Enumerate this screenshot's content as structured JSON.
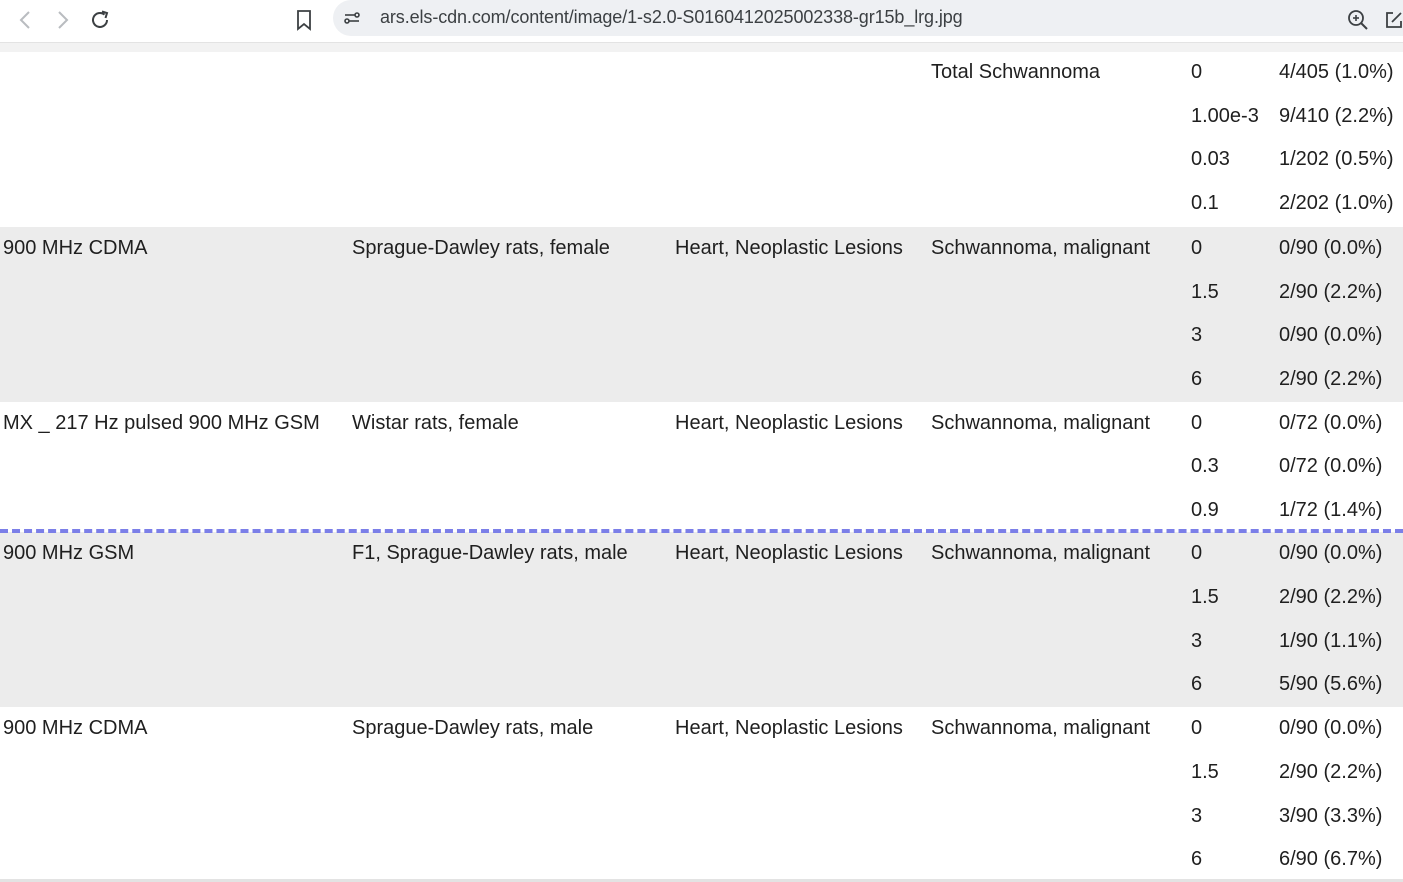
{
  "browser": {
    "url": "ars.els-cdn.com/content/image/1-s2.0-S0160412025002338-gr15b_lrg.jpg",
    "icons": [
      "back-icon",
      "forward-icon",
      "reload-icon",
      "bookmark-icon",
      "site-info-icon",
      "zoom-icon",
      "share-icon"
    ]
  },
  "table": {
    "groups": [
      {
        "exposure": "",
        "subject": "",
        "organ": "",
        "lesion": "Total Schwannoma",
        "shaded": false,
        "rows": [
          {
            "dose": "0",
            "incidence": "4/405 (1.0%)"
          },
          {
            "dose": "1.00e-3",
            "incidence": "9/410 (2.2%)"
          },
          {
            "dose": "0.03",
            "incidence": "1/202 (0.5%)"
          },
          {
            "dose": "0.1",
            "incidence": "2/202 (1.0%)"
          }
        ]
      },
      {
        "exposure": "900 MHz CDMA",
        "subject": "Sprague-Dawley rats, female",
        "organ": "Heart, Neoplastic Lesions",
        "lesion": "Schwannoma, malignant",
        "shaded": true,
        "rows": [
          {
            "dose": "0",
            "incidence": "0/90 (0.0%)"
          },
          {
            "dose": "1.5",
            "incidence": "2/90 (2.2%)"
          },
          {
            "dose": "3",
            "incidence": "0/90 (0.0%)"
          },
          {
            "dose": "6",
            "incidence": "2/90 (2.2%)"
          }
        ]
      },
      {
        "exposure": "MX _ 217 Hz pulsed 900 MHz GSM",
        "subject": "Wistar rats, female",
        "organ": "Heart, Neoplastic Lesions",
        "lesion": "Schwannoma, malignant",
        "shaded": false,
        "rows": [
          {
            "dose": "0",
            "incidence": "0/72 (0.0%)"
          },
          {
            "dose": "0.3",
            "incidence": "0/72 (0.0%)"
          },
          {
            "dose": "0.9",
            "incidence": "1/72 (1.4%)"
          }
        ]
      },
      {
        "exposure": "900 MHz GSM",
        "subject": "F1, Sprague-Dawley rats, male",
        "organ": "Heart, Neoplastic Lesions",
        "lesion": "Schwannoma, malignant",
        "shaded": true,
        "rows": [
          {
            "dose": "0",
            "incidence": "0/90 (0.0%)"
          },
          {
            "dose": "1.5",
            "incidence": "2/90 (2.2%)"
          },
          {
            "dose": "3",
            "incidence": "1/90 (1.1%)"
          },
          {
            "dose": "6",
            "incidence": "5/90 (5.6%)"
          }
        ]
      },
      {
        "exposure": "900 MHz CDMA",
        "subject": "Sprague-Dawley rats, male",
        "organ": "Heart, Neoplastic Lesions",
        "lesion": "Schwannoma, malignant",
        "shaded": false,
        "rows": [
          {
            "dose": "0",
            "incidence": "0/90 (0.0%)"
          },
          {
            "dose": "1.5",
            "incidence": "2/90 (2.2%)"
          },
          {
            "dose": "3",
            "incidence": "3/90 (3.3%)"
          },
          {
            "dose": "6",
            "incidence": "6/90 (6.7%)"
          }
        ]
      }
    ]
  }
}
